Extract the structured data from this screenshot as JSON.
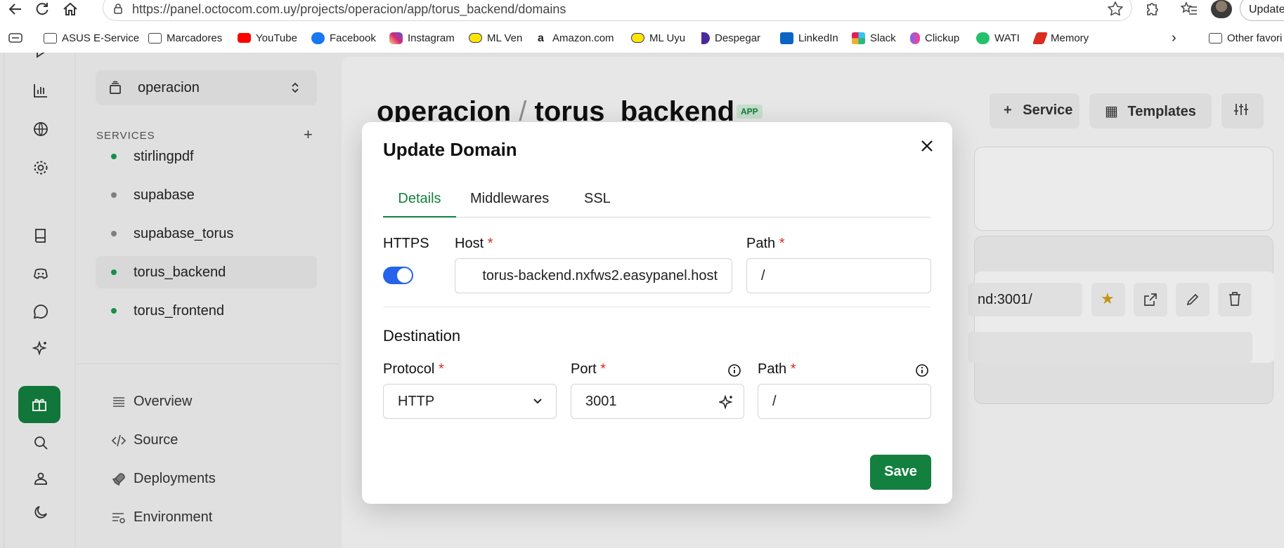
{
  "browser": {
    "url": "https://panel.octocom.com.uy/projects/operacion/app/torus_backend/domains",
    "update_label": "Update"
  },
  "bookmarks": [
    {
      "label": "ASUS E-Service",
      "icon": "folder-icon",
      "color": "#444444"
    },
    {
      "label": "Marcadores",
      "icon": "folder-icon",
      "color": "#444444"
    },
    {
      "label": "YouTube",
      "icon": "youtube-icon",
      "color": "#ff0000"
    },
    {
      "label": "Facebook",
      "icon": "facebook-icon",
      "color": "#1877f2"
    },
    {
      "label": "Instagram",
      "icon": "instagram-icon",
      "color": "#d62976"
    },
    {
      "label": "ML Ven",
      "icon": "mercadolibre-icon",
      "color": "#ffe600"
    },
    {
      "label": "Amazon.com",
      "icon": "amazon-icon",
      "color": "#111111"
    },
    {
      "label": "ML Uyu",
      "icon": "mercadolibre-icon",
      "color": "#ffe600"
    },
    {
      "label": "Despegar",
      "icon": "despegar-icon",
      "color": "#4b2a9c"
    },
    {
      "label": "LinkedIn",
      "icon": "linkedin-icon",
      "color": "#0a66c2"
    },
    {
      "label": "Slack",
      "icon": "slack-icon",
      "color": "#36c5f0"
    },
    {
      "label": "Clickup",
      "icon": "clickup-icon",
      "color": "#7b68ee"
    },
    {
      "label": "WATI",
      "icon": "wati-icon",
      "color": "#23c16b"
    },
    {
      "label": "Memory",
      "icon": "memory-icon",
      "color": "#d92d20"
    },
    {
      "label": "Other favori",
      "icon": "folder-icon",
      "color": "#444444"
    }
  ],
  "sidebar": {
    "project": "operacion",
    "services_label": "SERVICES",
    "services": [
      {
        "name": "stirlingpdf",
        "status_color": "#1a9e4b"
      },
      {
        "name": "supabase",
        "status_color": "#8a8a8a"
      },
      {
        "name": "supabase_torus",
        "status_color": "#8a8a8a"
      },
      {
        "name": "torus_backend",
        "status_color": "#1a9e4b"
      },
      {
        "name": "torus_frontend",
        "status_color": "#1a9e4b"
      }
    ],
    "menu": [
      {
        "label": "Overview",
        "icon": "list-icon"
      },
      {
        "label": "Source",
        "icon": "code-icon"
      },
      {
        "label": "Deployments",
        "icon": "rocket-icon"
      },
      {
        "label": "Environment",
        "icon": "env-settings-icon"
      }
    ]
  },
  "main": {
    "title_project": "operacion",
    "title_sep": "/",
    "title_app": "torus_backend",
    "badge": "APP",
    "service_btn": "Service",
    "templates_btn": "Templates",
    "domain_partial": "nd:3001/"
  },
  "modal": {
    "title": "Update Domain",
    "tabs": [
      "Details",
      "Middlewares",
      "SSL"
    ],
    "active_tab": "Details",
    "https_label": "HTTPS",
    "https_enabled": true,
    "host_label": "Host",
    "host_value": "torus-backend.nxfws2.easypanel.host",
    "path_label": "Path",
    "path_value": "/",
    "required_mark": "*",
    "destination_title": "Destination",
    "protocol_label": "Protocol",
    "protocol_value": "HTTP",
    "port_label": "Port",
    "port_value": "3001",
    "dest_path_label": "Path",
    "dest_path_value": "/",
    "save_label": "Save",
    "accent": "#13803f",
    "toggle_color": "#2563eb"
  }
}
